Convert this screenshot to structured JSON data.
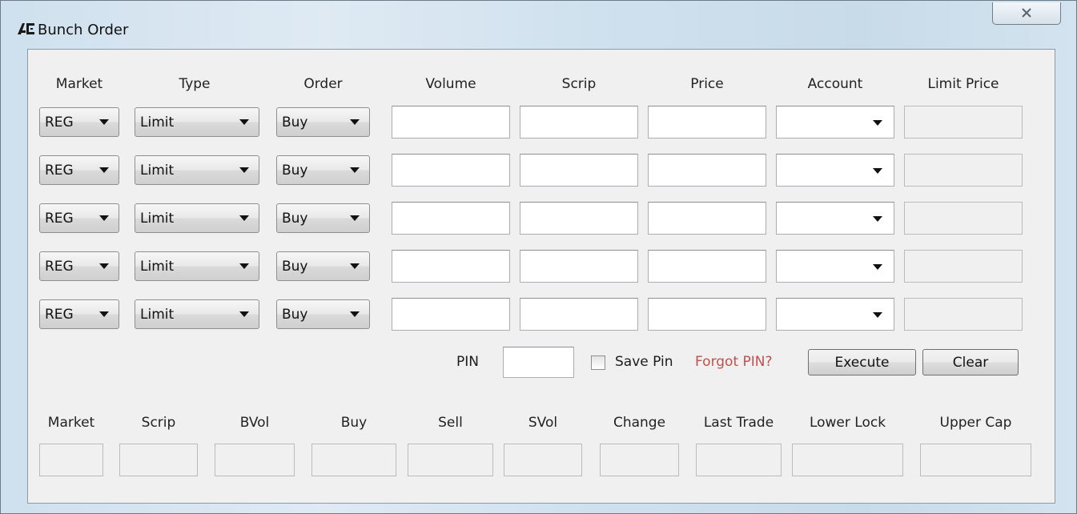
{
  "window": {
    "title": "Bunch Order",
    "app_icon": "ai-logo-icon",
    "close_icon": "close-x-icon"
  },
  "headers": [
    "Market",
    "Type",
    "Order",
    "Volume",
    "Scrip",
    "Price",
    "Account",
    "Limit Price"
  ],
  "rows": [
    {
      "market": "REG",
      "type": "Limit",
      "order": "Buy",
      "volume": "",
      "scrip": "",
      "price": "",
      "account": "",
      "limit_price": ""
    },
    {
      "market": "REG",
      "type": "Limit",
      "order": "Buy",
      "volume": "",
      "scrip": "",
      "price": "",
      "account": "",
      "limit_price": ""
    },
    {
      "market": "REG",
      "type": "Limit",
      "order": "Buy",
      "volume": "",
      "scrip": "",
      "price": "",
      "account": "",
      "limit_price": ""
    },
    {
      "market": "REG",
      "type": "Limit",
      "order": "Buy",
      "volume": "",
      "scrip": "",
      "price": "",
      "account": "",
      "limit_price": ""
    },
    {
      "market": "REG",
      "type": "Limit",
      "order": "Buy",
      "volume": "",
      "scrip": "",
      "price": "",
      "account": "",
      "limit_price": ""
    }
  ],
  "pin": {
    "label": "PIN",
    "value": "",
    "save_label": "Save Pin",
    "save_checked": false,
    "forgot_label": "Forgot PIN?"
  },
  "actions": {
    "execute": "Execute",
    "clear": "Clear"
  },
  "info": {
    "labels": [
      "Market",
      "Scrip",
      "BVol",
      "Buy",
      "Sell",
      "SVol",
      "Change",
      "Last Trade",
      "Lower Lock",
      "Upper Cap"
    ],
    "values": [
      "",
      "",
      "",
      "",
      "",
      "",
      "",
      "",
      "",
      ""
    ]
  },
  "colors": {
    "forgot_link": "#c0504d",
    "dialog_bg": "#f0f0f0",
    "frame": "#cfe0ee"
  }
}
